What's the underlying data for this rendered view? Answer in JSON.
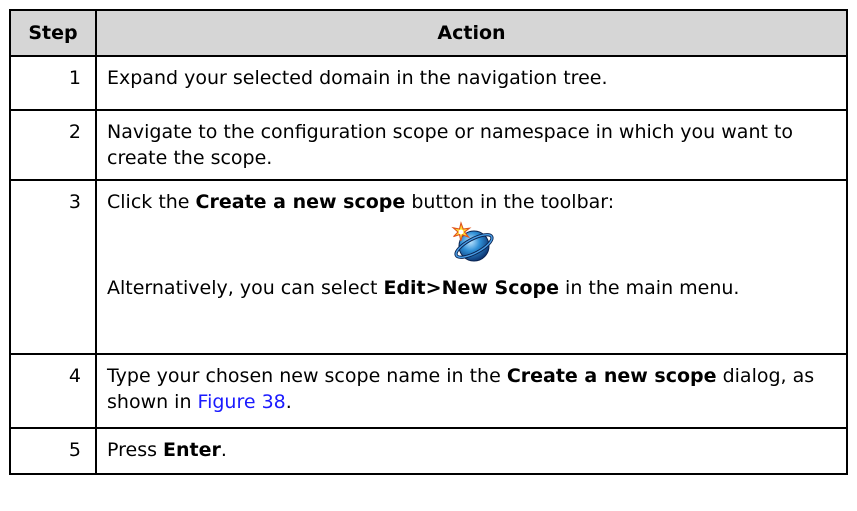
{
  "table": {
    "header_step": "Step",
    "header_action": "Action",
    "rows": [
      {
        "num": "1",
        "text": "Expand your selected domain in the navigation tree."
      },
      {
        "num": "2",
        "text": "Navigate to the configuration scope or namespace in which you want to create the scope."
      },
      {
        "num": "3",
        "line1_pre": "Click the ",
        "line1_bold": "Create a new scope",
        "line1_post": " button in the toolbar:",
        "icon": "create-scope-icon",
        "line2_pre": "Alternatively, you can select ",
        "line2_bold": "Edit>New Scope",
        "line2_post": " in the main menu."
      },
      {
        "num": "4",
        "pre": "Type your chosen new scope name in the ",
        "bold": "Create a new scope",
        "mid": " dialog, as shown in ",
        "link": "Figure 38",
        "post": "."
      },
      {
        "num": "5",
        "pre": "Press ",
        "bold": "Enter",
        "post": "."
      }
    ]
  },
  "colors": {
    "header_bg": "#d6d6d6",
    "link": "#1a1aff",
    "border": "#000000"
  }
}
